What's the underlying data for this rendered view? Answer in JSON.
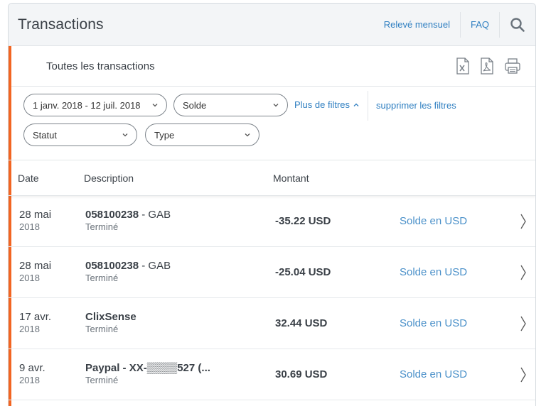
{
  "header": {
    "title": "Transactions",
    "monthly_statement": "Relevé mensuel",
    "faq": "FAQ"
  },
  "subheader": {
    "title": "Toutes les transactions"
  },
  "filters": {
    "date_range": "1 janv. 2018 - 12 juil. 2018",
    "balance": "Solde",
    "status": "Statut",
    "type": "Type",
    "more_filters": "Plus de filtres",
    "clear_filters": "supprimer les filtres"
  },
  "table": {
    "headers": {
      "date": "Date",
      "description": "Description",
      "amount": "Montant"
    },
    "rows": [
      {
        "date": "28 mai",
        "year": "2018",
        "desc_bold": "058100238",
        "desc_rest": " - GAB",
        "status": "Terminé",
        "amount": "-35.22 USD",
        "balance": "Solde en USD"
      },
      {
        "date": "28 mai",
        "year": "2018",
        "desc_bold": "058100238",
        "desc_rest": " - GAB",
        "status": "Terminé",
        "amount": "-25.04 USD",
        "balance": "Solde en USD"
      },
      {
        "date": "17 avr.",
        "year": "2018",
        "desc_bold": "ClixSense",
        "desc_rest": "",
        "status": "Terminé",
        "amount": "32.44 USD",
        "balance": "Solde en USD"
      },
      {
        "date": "9 avr.",
        "year": "2018",
        "desc_bold": "Paypal - XX-▒▒▒▒527 (...",
        "desc_rest": "",
        "status": "Terminé",
        "amount": "30.69 USD",
        "balance": "Solde en USD"
      }
    ]
  },
  "colors": {
    "accent": "#f26522",
    "link": "#2f7fc1"
  }
}
